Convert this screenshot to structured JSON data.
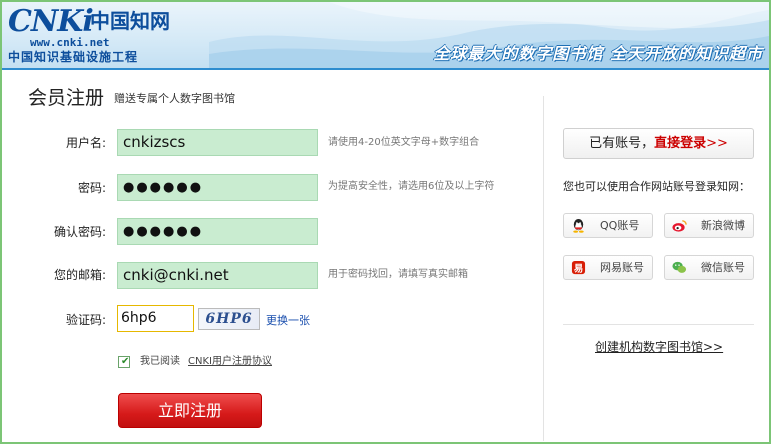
{
  "header": {
    "logo_cnki": "CNKi",
    "logo_cn": "中国知网",
    "logo_url": "www.cnki.net",
    "logo_project": "中国知识基础设施工程",
    "slogan": "全球最大的数字图书馆  全天开放的知识超市"
  },
  "page": {
    "title": "会员注册",
    "subtitle": "赠送专属个人数字图书馆"
  },
  "form": {
    "username": {
      "label": "用户名:",
      "value": "cnkizscs",
      "hint": "请使用4-20位英文字母+数字组合"
    },
    "password": {
      "label": "密码:",
      "value": "●●●●●●",
      "hint": "为提高安全性，请选用6位及以上字符"
    },
    "confirm": {
      "label": "确认密码:",
      "value": "●●●●●●"
    },
    "email": {
      "label": "您的邮箱:",
      "value": "cnki@cnki.net",
      "hint": "用于密码找回，请填写真实邮箱"
    },
    "captcha": {
      "label": "验证码:",
      "value": "6hp6",
      "image_text": "6HP6",
      "refresh": "更换一张"
    },
    "agree": {
      "checked": true,
      "mark": "✔",
      "text": "我已阅读",
      "link": "CNKI用户注册协议"
    },
    "submit": "立即注册"
  },
  "sidebar": {
    "has_account": "已有账号，",
    "login_link": "直接登录",
    "login_arrows": ">>",
    "partner_tip": "您也可以使用合作网站账号登录知网：",
    "partners": [
      {
        "label": "QQ账号",
        "icon": "qq-icon"
      },
      {
        "label": "新浪微博",
        "icon": "weibo-icon"
      },
      {
        "label": "网易账号",
        "icon": "netease-icon"
      },
      {
        "label": "微信账号",
        "icon": "wechat-icon"
      }
    ],
    "create_library": "创建机构数字图书馆>>"
  },
  "colors": {
    "accent_green": "#7cc576",
    "field_bg": "#c9ecd0",
    "button_red": "#d61a1a",
    "link_blue": "#1a4fae",
    "header_blue": "#2e8ccf"
  }
}
